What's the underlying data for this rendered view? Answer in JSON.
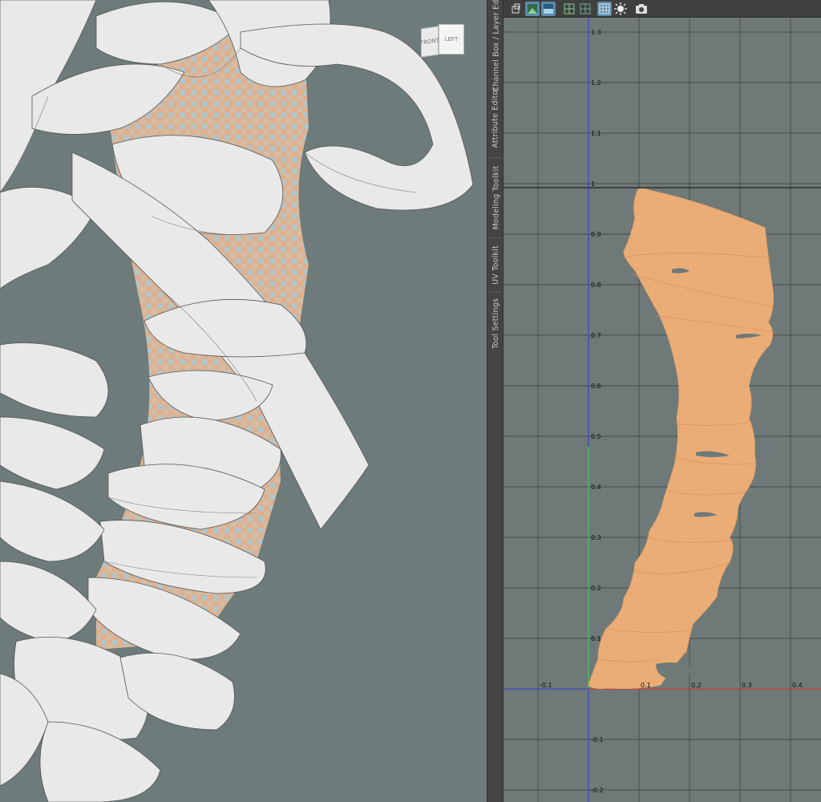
{
  "viewport": {
    "viewcube": {
      "front_label": "FRONT",
      "left_label": "LEFT"
    }
  },
  "side_tabs": [
    {
      "label": "Channel Box / Layer Editor"
    },
    {
      "label": "Attribute Editor"
    },
    {
      "label": "Modeling Toolkit"
    },
    {
      "label": "UV Toolkit"
    },
    {
      "label": "Tool Settings"
    }
  ],
  "uv_editor": {
    "toolbar_icons": [
      "uv-shell-icon",
      "checker-map-icon",
      "texture-display-icon",
      "grid-toggle-icon",
      "pixel-snap-icon",
      "uv-grid-icon",
      "shading-icon",
      "snapshot-camera-icon"
    ],
    "u_ticks": [
      "-0.1",
      "0.1",
      "0.2",
      "0.3",
      "0.4"
    ],
    "v_ticks": [
      "1.3",
      "1.2",
      "1.1",
      "1",
      "0.9",
      "0.8",
      "0.7",
      "0.6",
      "0.5",
      "0.4",
      "0.3",
      "0.2",
      "0.1",
      "-0.1",
      "-0.2"
    ],
    "colors": {
      "uv_shell": "#edb07a",
      "u_axis": "#d23b2e",
      "v_axis": "#2d3bd0",
      "grid": "#3a3f3f",
      "background": "#6f7978"
    }
  },
  "scene_colors": {
    "ribbon": "#e8e8e8",
    "ribbon_shade": "#c8cbcb",
    "texture_orange": "#e7b28e",
    "texture_blue": "#a8c3c9"
  }
}
